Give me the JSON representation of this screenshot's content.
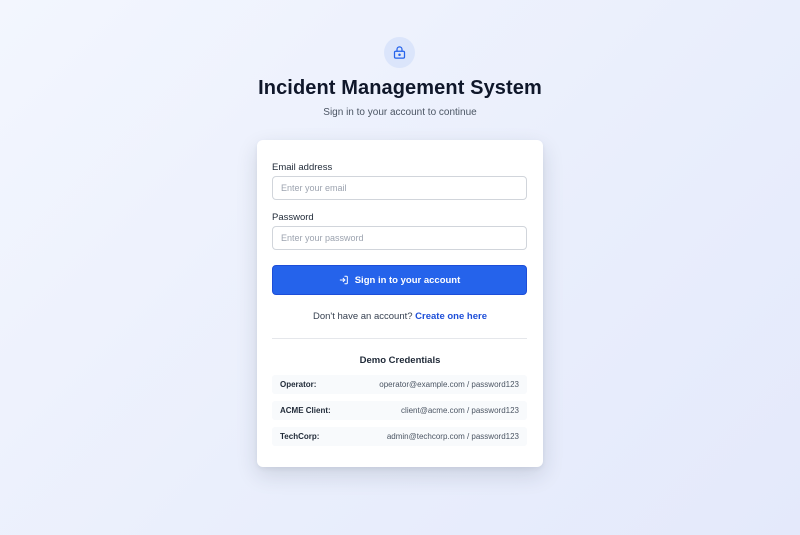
{
  "header": {
    "icon": "lock-icon",
    "title": "Incident Management System",
    "subtitle": "Sign in to your account to continue"
  },
  "form": {
    "email_label": "Email address",
    "email_placeholder": "Enter your email",
    "email_value": "",
    "password_label": "Password",
    "password_placeholder": "Enter your password",
    "password_value": "",
    "submit_icon": "sign-in-icon",
    "submit_label": "Sign in to your account"
  },
  "signup": {
    "prompt": "Don't have an account?",
    "link_label": "Create one here"
  },
  "demo": {
    "title": "Demo Credentials",
    "credentials": [
      {
        "name": "Operator:",
        "value": "operator@example.com / password123"
      },
      {
        "name": "ACME Client:",
        "value": "client@acme.com / password123"
      },
      {
        "name": "TechCorp:",
        "value": "admin@techcorp.com / password123"
      }
    ]
  },
  "colors": {
    "accent": "#2563eb",
    "link": "#1d4ed8",
    "background": "#eef2fd"
  }
}
